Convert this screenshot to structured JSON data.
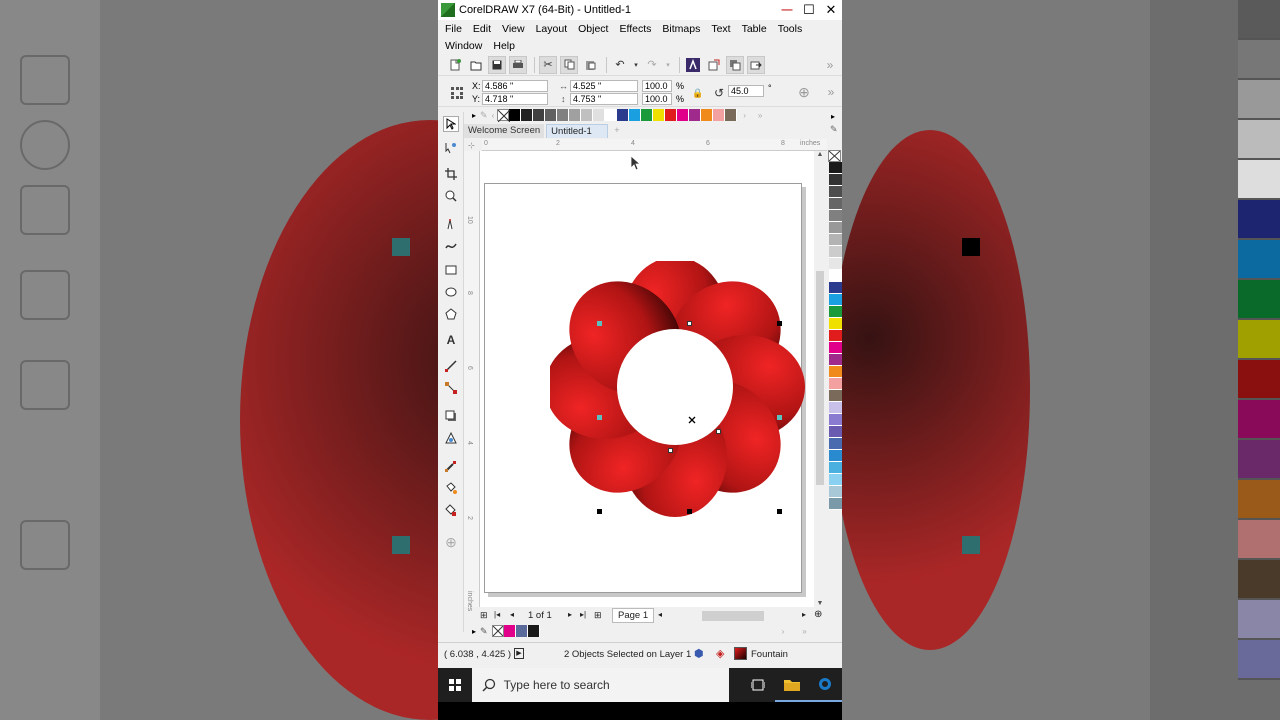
{
  "window": {
    "title": "CorelDRAW X7 (64-Bit) - Untitled-1",
    "min_glyph": "—",
    "max_glyph": "☐",
    "close_glyph": "✕"
  },
  "menu": {
    "row1": [
      "File",
      "Edit",
      "View",
      "Layout",
      "Object",
      "Effects",
      "Bitmaps",
      "Text",
      "Table",
      "Tools"
    ],
    "row2": [
      "Window",
      "Help"
    ]
  },
  "property_bar": {
    "x_label": "X:",
    "x_value": "4.586 \"",
    "y_label": "Y:",
    "y_value": "4.718 \"",
    "w_value": "4.525 \"",
    "h_value": "4.753 \"",
    "scale_x": "100.0",
    "scale_y": "100.0",
    "percent": "%",
    "rotation": "45.0",
    "degree": "°"
  },
  "doc_tabs": {
    "welcome": "Welcome Screen",
    "doc": "Untitled-1",
    "add": "+"
  },
  "rulers": {
    "unit": "inches",
    "h_ticks": [
      "0",
      "2",
      "4",
      "6",
      "8"
    ],
    "v_ticks": [
      "10",
      "8",
      "6",
      "4",
      "2"
    ]
  },
  "page_nav": {
    "page_count": "1 of 1",
    "page_tab": "Page 1"
  },
  "status": {
    "coords": "( 6.038 , 4.425 )",
    "selection": "2 Objects Selected on Layer 1",
    "fill_label": "Fountain"
  },
  "taskbar": {
    "search_placeholder": "Type here to search"
  },
  "colors": {
    "accent_red": "#d01c1c",
    "dark_red": "#1a0000",
    "swatches": [
      "#000000",
      "#222222",
      "#404040",
      "#606060",
      "#808080",
      "#a0a0a0",
      "#c0c0c0",
      "#e0e0e0",
      "#ffffff",
      "#2a3a8c",
      "#1aa0e0",
      "#1a9a3a",
      "#f0e000",
      "#e01c1c",
      "#e0008a",
      "#a02a8c",
      "#f08a1a",
      "#f2a0a0",
      "#7a6a5a"
    ],
    "side_palette": [
      "#1a1a1a",
      "#333333",
      "#4d4d4d",
      "#666666",
      "#808080",
      "#999999",
      "#b3b3b3",
      "#cccccc",
      "#e6e6e6",
      "#ffffff",
      "#2a3a8c",
      "#1aa0e0",
      "#1a9a3a",
      "#f0e000",
      "#e01c1c",
      "#e0008a",
      "#a02a8c",
      "#f08a1a",
      "#f2a0a0",
      "#7a6a5a",
      "#c8c0e8",
      "#8a7ad0",
      "#6a5ab0",
      "#4a6ab0",
      "#2a8ad0",
      "#4ab0e0",
      "#8ad0f0",
      "#a8c8d8",
      "#7a9aaa"
    ],
    "doc_palette": [
      "#e0008a",
      "#5a6a9a",
      "#1a1a1a"
    ]
  }
}
